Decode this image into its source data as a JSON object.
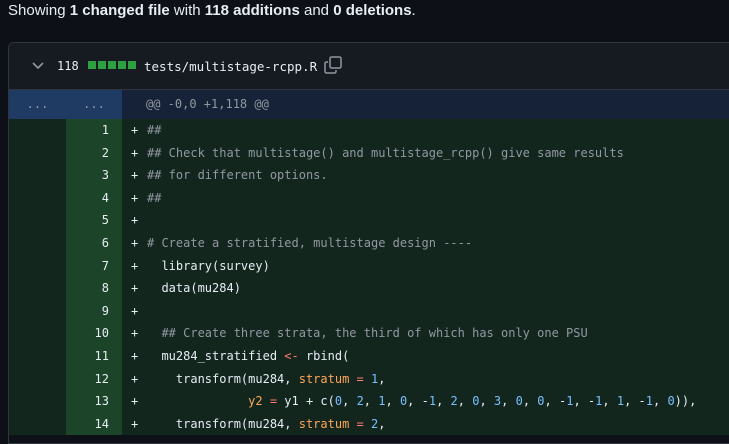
{
  "summary": {
    "prefix": "Showing ",
    "files": "1 changed file",
    "mid": " with ",
    "additions": "118 additions",
    "and": " and ",
    "deletions": "0 deletions",
    "suffix": "."
  },
  "file": {
    "change_count": "118",
    "diffstat_blocks": 5,
    "path": "tests/multistage-rcpp.R",
    "hunk_old": "...",
    "hunk_new": "...",
    "hunk_header": "@@ -0,0 +1,118 @@",
    "colors": {
      "addition_bg": "#12261e",
      "addition_gutter": "#1c4428",
      "hunk_bg": "#1f3a63",
      "diffstat": "#2ea043"
    }
  },
  "lines": [
    {
      "n": "1",
      "sign": "+",
      "code": "##"
    },
    {
      "n": "2",
      "sign": "+",
      "code": "## Check that multistage() and multistage_rcpp() give same results"
    },
    {
      "n": "3",
      "sign": "+",
      "code": "## for different options."
    },
    {
      "n": "4",
      "sign": "+",
      "code": "##"
    },
    {
      "n": "5",
      "sign": "+",
      "code": ""
    },
    {
      "n": "6",
      "sign": "+",
      "code": "# Create a stratified, multistage design ----"
    },
    {
      "n": "7",
      "sign": "+",
      "code": "  library(survey)"
    },
    {
      "n": "8",
      "sign": "+",
      "code": "  data(mu284)"
    },
    {
      "n": "9",
      "sign": "+",
      "code": ""
    },
    {
      "n": "10",
      "sign": "+",
      "code": "  ## Create three strata, the third of which has only one PSU"
    },
    {
      "n": "11",
      "sign": "+",
      "code": "  mu284_stratified <- rbind("
    },
    {
      "n": "12",
      "sign": "+",
      "code": "    transform(mu284, stratum = 1,"
    },
    {
      "n": "13",
      "sign": "+",
      "code": "              y2 = y1 + c(0, 2, 1, 0, -1, 2, 0, 3, 0, 0, -1, -1, 1, -1, 0)),"
    },
    {
      "n": "14",
      "sign": "+",
      "code": "    transform(mu284, stratum = 2,"
    }
  ]
}
